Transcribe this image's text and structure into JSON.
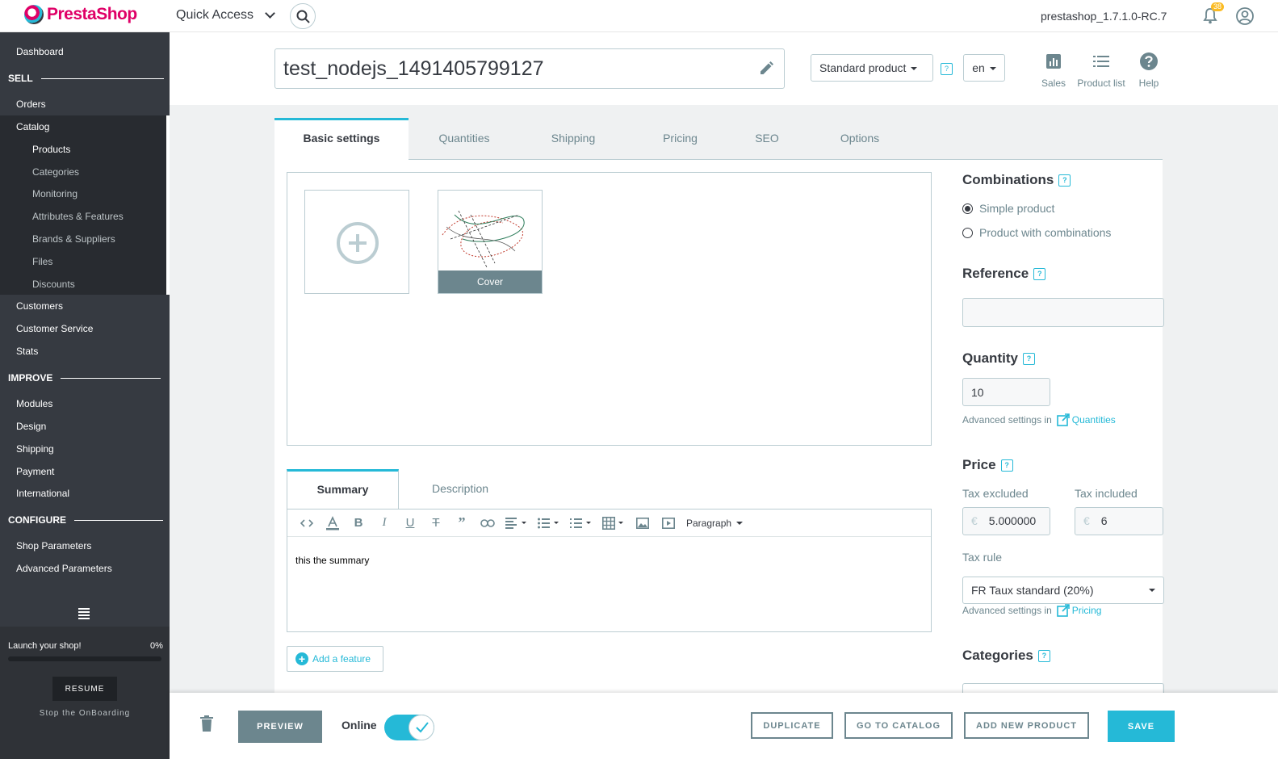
{
  "header": {
    "logo_text": "PrestaShop",
    "quick_access": "Quick Access",
    "shop_name": "prestashop_1.7.1.0-RC.7",
    "notifications_count": "38"
  },
  "sidebar": {
    "dashboard": "Dashboard",
    "sell": "SELL",
    "orders": "Orders",
    "catalog": "Catalog",
    "catalog_items": [
      "Products",
      "Categories",
      "Monitoring",
      "Attributes & Features",
      "Brands & Suppliers",
      "Files",
      "Discounts"
    ],
    "customers": "Customers",
    "customer_service": "Customer Service",
    "stats": "Stats",
    "improve": "IMPROVE",
    "modules": "Modules",
    "design": "Design",
    "shipping": "Shipping",
    "payment": "Payment",
    "international": "International",
    "configure": "CONFIGURE",
    "shop_parameters": "Shop Parameters",
    "advanced_parameters": "Advanced Parameters",
    "launch_label": "Launch your shop!",
    "launch_pct": "0%",
    "launch_progress": 0,
    "resume": "RESUME",
    "stop_onboarding": "Stop the OnBoarding"
  },
  "product": {
    "name": "test_nodejs_1491405799127",
    "type": "Standard product",
    "lang": "en",
    "help_q": "?",
    "header_links": [
      "Sales",
      "Product list",
      "Help"
    ]
  },
  "tabs": [
    "Basic settings",
    "Quantities",
    "Shipping",
    "Pricing",
    "SEO",
    "Options"
  ],
  "images": {
    "cover_label": "Cover"
  },
  "summary": {
    "tabs": [
      "Summary",
      "Description"
    ],
    "paragraph": "Paragraph",
    "text": "this the summary"
  },
  "add_feature": "Add a feature",
  "right": {
    "combinations": "Combinations",
    "simple_product": "Simple product",
    "product_with_combinations": "Product with combinations",
    "reference": "Reference",
    "reference_value": "",
    "quantity": "Quantity",
    "quantity_value": "10",
    "advanced_settings_in": "Advanced settings in",
    "quantities_link": "Quantities",
    "price": "Price",
    "tax_excluded": "Tax excluded",
    "tax_included": "Tax included",
    "currency": "€",
    "price_excl": "5.000000",
    "price_incl": "6",
    "tax_rule": "Tax rule",
    "tax_rule_value": "FR Taux standard (20%)",
    "pricing_link": "Pricing",
    "categories": "Categories"
  },
  "footer": {
    "preview": "PREVIEW",
    "online": "Online",
    "duplicate": "DUPLICATE",
    "go_to_catalog": "GO TO CATALOG",
    "add_new_product": "ADD NEW PRODUCT",
    "save": "SAVE"
  },
  "colors": {
    "accent": "#25b9d7",
    "brand": "#df0067",
    "sidebar": "#363a41"
  }
}
